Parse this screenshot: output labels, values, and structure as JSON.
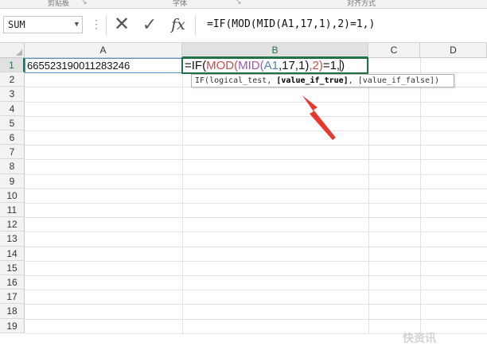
{
  "ribbon": {
    "groups": [
      "剪贴板",
      "字体",
      "对齐方式"
    ]
  },
  "formula_bar": {
    "name_box": "SUM",
    "cancel_icon": "cross-icon",
    "enter_icon": "check-icon",
    "fx_label": "fx",
    "formula": "=IF(MOD(MID(A1,17,1),2)=1,)"
  },
  "columns": [
    "A",
    "B",
    "C",
    "D"
  ],
  "rows": [
    "1",
    "2",
    "3",
    "4",
    "5",
    "6",
    "7",
    "8",
    "9",
    "10",
    "11",
    "12",
    "13",
    "14",
    "15",
    "16",
    "17",
    "18",
    "19"
  ],
  "cells": {
    "A1": "665523190011283246",
    "B1": {
      "prefix": "=IF(",
      "fn_mod": "MOD(",
      "fn_mid": "MID(",
      "ref": "A1",
      "mid_args": ",17,1)",
      "mod_args": ",2)",
      "suffix": "=1,",
      "close": ")"
    }
  },
  "tooltip": {
    "fn": "IF(",
    "arg1": "logical_test, ",
    "arg2": "[value_if_true]",
    "arg3": ", [value_if_false])"
  },
  "annotation": {
    "icon": "red-arrow-icon",
    "color": "#e8392f"
  },
  "watermark": "快资讯"
}
